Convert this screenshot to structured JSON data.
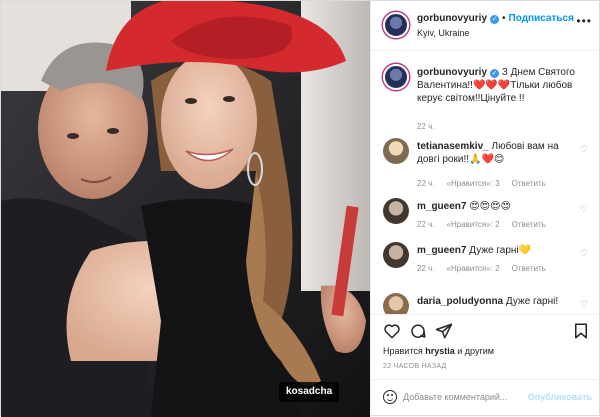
{
  "post": {
    "username": "gorbunovyuriy",
    "follow_label": "Подписаться",
    "location": "Kyiv, Ukraine",
    "caption": "З Днем Святого Валентина!!❤️❤️❤️Тільки любов керує світом!!Цінуйте !!",
    "caption_time": "22 ч.",
    "tag": "kosadcha"
  },
  "comments": [
    {
      "user": "tetianasemkiv_",
      "text": "Любові вам на довгі роки!!🙏❤️😊",
      "time": "22 ч.",
      "likes": "«Нравится»: 3",
      "reply": "Ответить"
    },
    {
      "user": "m_gueen7",
      "text": "😍😍😍😍",
      "time": "22 ч.",
      "likes": "«Нравится»: 2",
      "reply": "Ответить"
    },
    {
      "user": "m_gueen7",
      "text": "Дуже гарні💛",
      "time": "22 ч.",
      "likes": "«Нравится»: 2",
      "reply": "Ответить"
    },
    {
      "user": "daria_poludyonna",
      "text": "Дуже гарні!",
      "time": "",
      "likes": "",
      "reply": ""
    }
  ],
  "likes_text": "Нравится",
  "likes_user": "hrystia",
  "likes_tail": "и другим",
  "time_ago": "22 ЧАСОВ НАЗАД",
  "comment_placeholder": "Добавьте комментарий...",
  "publish_label": "Опубликовать",
  "icons": [
    "more-icon",
    "heart-icon",
    "comment-icon",
    "share-icon",
    "bookmark-icon",
    "emoji-icon",
    "verified-icon"
  ],
  "colors": {
    "accent": "#0095f6",
    "heart": "#ed4956",
    "hat": "#d42a2e"
  }
}
